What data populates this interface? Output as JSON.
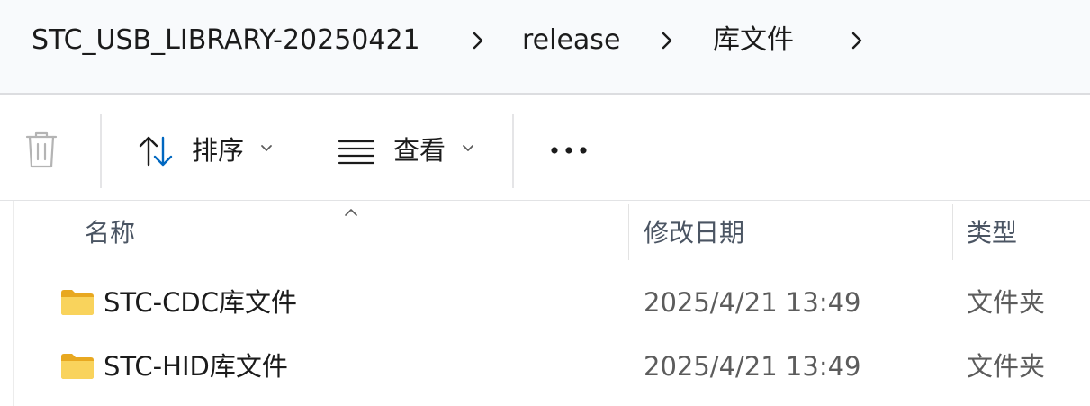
{
  "breadcrumb": {
    "items": [
      "STC_USB_LIBRARY-20250421",
      "release",
      "库文件"
    ]
  },
  "toolbar": {
    "sort_label": "排序",
    "view_label": "查看",
    "more_label": "•••"
  },
  "columns": {
    "name": "名称",
    "modified": "修改日期",
    "type": "类型"
  },
  "files": [
    {
      "name": "STC-CDC库文件",
      "modified": "2025/4/21 13:49",
      "type": "文件夹"
    },
    {
      "name": "STC-HID库文件",
      "modified": "2025/4/21 13:49",
      "type": "文件夹"
    }
  ],
  "colors": {
    "accent": "#0067c0",
    "folder": "#f5c64a"
  }
}
